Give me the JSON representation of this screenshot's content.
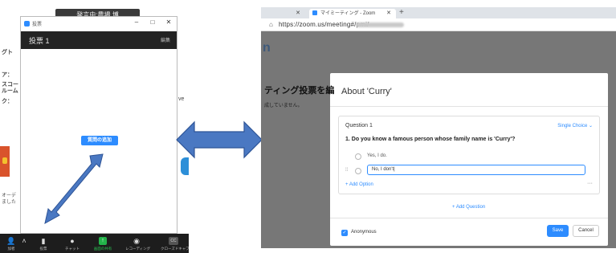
{
  "left_app": {
    "tooltip": "発言中:農場 博",
    "window_title": "投票",
    "window_controls": [
      "–",
      "□",
      "✕"
    ],
    "poll_title": "投票 1",
    "edit_label": "編集",
    "add_question_label": "質問の追加",
    "background_text": [
      "グト",
      "ア：",
      "スコー",
      "ルーム",
      "ク："
    ],
    "background_small": [
      "オーデ",
      "ました"
    ],
    "right_edge_letter": "ve",
    "toolbar": [
      {
        "icon": "participants-icon",
        "glyph": "👤",
        "label": "加者",
        "count": "1"
      },
      {
        "icon": "up-caret-icon",
        "glyph": "˄",
        "label": ""
      },
      {
        "icon": "polls-icon",
        "glyph": "▮",
        "label": "投票"
      },
      {
        "icon": "chat-icon",
        "glyph": "●",
        "label": "チャット"
      },
      {
        "icon": "share-screen-icon",
        "glyph": "↑",
        "label": "画面の共有"
      },
      {
        "icon": "record-icon",
        "glyph": "◉",
        "label": "レコーディング"
      },
      {
        "icon": "closed-caption-icon",
        "glyph": "CC",
        "label": "クローズドキャプ"
      }
    ]
  },
  "browser": {
    "tabs": [
      {
        "label": "",
        "active": false
      },
      {
        "label": "マイミーティング - Zoom",
        "active": true
      }
    ],
    "url": "https://zoom.us/meeting#/pmi/",
    "logo_letter": "n",
    "background_title": "ティング投票を編",
    "background_subtitle": "成していません。"
  },
  "modal": {
    "title": "About 'Curry'",
    "question_label": "Question 1",
    "question_type": "Single Choice",
    "question_text": "1. Do you know a famous person whose family name is 'Curry'?",
    "options": [
      "Yes, I do.",
      "No, I don't|"
    ],
    "add_option": "+ Add Option",
    "add_question": "+ Add Question",
    "anonymous_label": "Anonymous",
    "save_label": "Save",
    "cancel_label": "Cancel"
  },
  "colors": {
    "zoom_blue": "#2d8cff",
    "toolbar_dark": "#1d1d1d",
    "arrow_blue": "#4a78c2",
    "share_green": "#23b34a"
  }
}
